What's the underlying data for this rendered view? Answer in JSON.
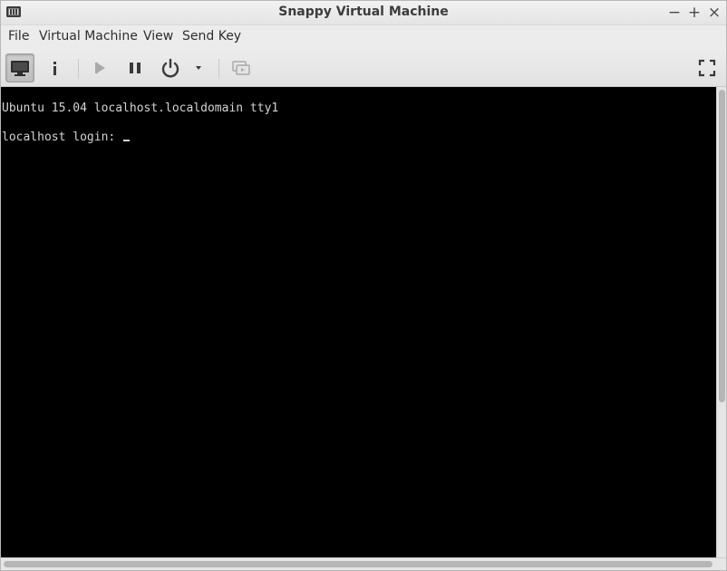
{
  "window": {
    "title": "Snappy Virtual Machine",
    "controls": {
      "minimize": "−",
      "maximize": "+",
      "close": "×"
    }
  },
  "menubar": {
    "items": [
      "File",
      "Virtual Machine",
      "View",
      "Send Key"
    ]
  },
  "toolbar": {
    "buttons": [
      {
        "name": "console",
        "icon": "monitor-icon",
        "active": true
      },
      {
        "name": "details",
        "icon": "info-icon"
      },
      {
        "name": "run",
        "icon": "play-icon",
        "enabled": false
      },
      {
        "name": "pause",
        "icon": "pause-icon"
      },
      {
        "name": "shutdown",
        "icon": "power-icon"
      },
      {
        "name": "shutdown-menu",
        "icon": "dropdown-arrow-icon"
      },
      {
        "name": "snapshots",
        "icon": "snapshots-icon",
        "enabled": false
      },
      {
        "name": "fullscreen",
        "icon": "fullscreen-icon"
      }
    ]
  },
  "console": {
    "background": "#000000",
    "text_color": "#d4d4d4",
    "lines": [
      "Ubuntu 15.04 localhost.localdomain tty1",
      "localhost login: "
    ]
  }
}
